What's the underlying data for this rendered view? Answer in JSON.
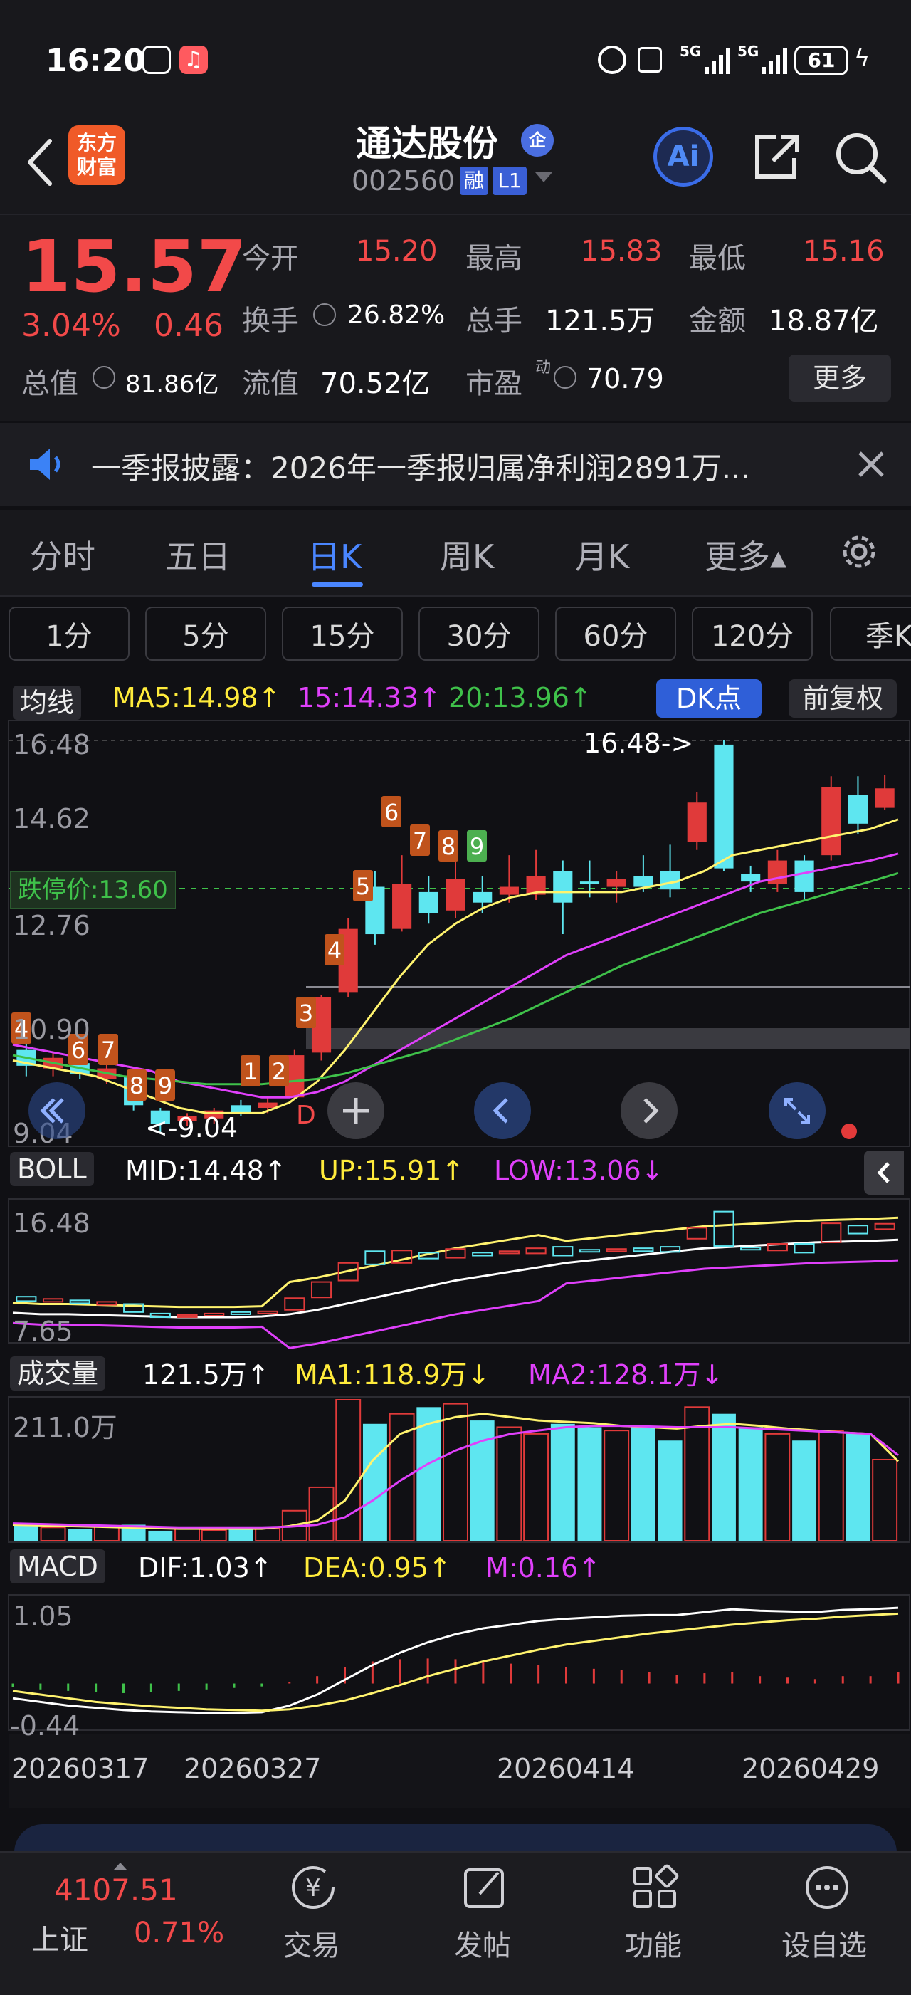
{
  "status": {
    "time": "16:20",
    "battery": "61",
    "net1": "5G",
    "net2": "5G"
  },
  "header": {
    "stock_name": "通达股份",
    "badge": "企",
    "stock_code": "002560",
    "tag_rong": "融",
    "tag_level": "L1",
    "logo_line1": "东方",
    "logo_line2": "财富",
    "ai_label": "Ai"
  },
  "quote": {
    "price": "15.57",
    "change_pct": "3.04%",
    "change_amt": "0.46",
    "open_label": "今开",
    "open": "15.20",
    "high_label": "最高",
    "high": "15.83",
    "low_label": "最低",
    "low": "15.16",
    "turnover_label": "换手",
    "turnover": "26.82%",
    "volume_label": "总手",
    "volume": "121.5万",
    "amount_label": "金额",
    "amount": "18.87亿",
    "mktcap_label": "总值",
    "mktcap": "81.86亿",
    "float_label": "流值",
    "float_cap": "70.52亿",
    "pe_label": "市盈",
    "pe_sup": "动",
    "pe": "70.79",
    "more_button": "更多"
  },
  "notice": {
    "text": "一季报披露：2026年一季报归属净利润2891万..."
  },
  "tabs": [
    "分时",
    "五日",
    "日K",
    "周K",
    "月K",
    "更多▴"
  ],
  "active_tab": "日K",
  "periods": [
    "1分",
    "5分",
    "15分",
    "30分",
    "60分",
    "120分",
    "季K"
  ],
  "ma_legend": {
    "dropdown": "均线",
    "ma5": "MA5:14.98",
    "ma15": "15:14.33",
    "ma20": "20:13.96",
    "dk_button": "DK点",
    "adjust_button": "前复权"
  },
  "kline": {
    "ticks": [
      "16.48",
      "14.62",
      "12.76",
      "10.90",
      "9.04"
    ],
    "limit_label": "跌停价:13.60",
    "max_annot": "16.48->",
    "min_annot": "<-9.04",
    "d_marker": "D",
    "nine_turn": [
      "4",
      "6",
      "7",
      "8",
      "9",
      "1",
      "2",
      "3",
      "4",
      "5",
      "6",
      "7",
      "8",
      "9"
    ]
  },
  "boll": {
    "dropdown": "BOLL",
    "mid": "MID:14.48",
    "up": "UP:15.91",
    "low": "LOW:13.06",
    "tick_top": "16.48",
    "tick_bottom": "7.65"
  },
  "volume_panel": {
    "dropdown": "成交量",
    "vol": "121.5万",
    "ma1": "MA1:118.9万",
    "ma2": "MA2:128.1万",
    "tick_top": "211.0万"
  },
  "macd": {
    "dropdown": "MACD",
    "dif": "DIF:1.03",
    "dea": "DEA:0.95",
    "m": "M:0.16",
    "tick_top": "1.05",
    "tick_bottom": "-0.44"
  },
  "dates": [
    "20260317",
    "20260327",
    "20260414",
    "20260429"
  ],
  "bottom_nav": {
    "index_value": "4107.51",
    "index_name": "上证",
    "index_pct": "0.71%",
    "items": [
      "交易",
      "发帖",
      "功能",
      "设自选"
    ]
  },
  "colors": {
    "up": "#e03a3a",
    "down": "#5ee6f0",
    "ma5": "#fff36e",
    "ma10": "#e040fb",
    "ma20": "#3fc14a",
    "bg": "#101014"
  }
}
